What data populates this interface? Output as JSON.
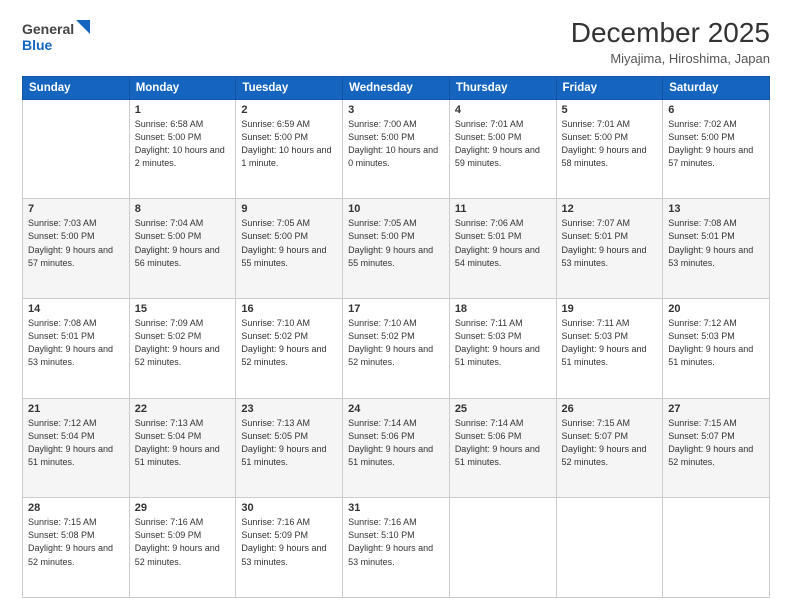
{
  "header": {
    "logo_line1": "General",
    "logo_line2": "Blue",
    "month": "December 2025",
    "location": "Miyajima, Hiroshima, Japan"
  },
  "weekdays": [
    "Sunday",
    "Monday",
    "Tuesday",
    "Wednesday",
    "Thursday",
    "Friday",
    "Saturday"
  ],
  "weeks": [
    [
      {
        "day": "",
        "text": ""
      },
      {
        "day": "1",
        "text": "Sunrise: 6:58 AM\nSunset: 5:00 PM\nDaylight: 10 hours\nand 2 minutes."
      },
      {
        "day": "2",
        "text": "Sunrise: 6:59 AM\nSunset: 5:00 PM\nDaylight: 10 hours\nand 1 minute."
      },
      {
        "day": "3",
        "text": "Sunrise: 7:00 AM\nSunset: 5:00 PM\nDaylight: 10 hours\nand 0 minutes."
      },
      {
        "day": "4",
        "text": "Sunrise: 7:01 AM\nSunset: 5:00 PM\nDaylight: 9 hours\nand 59 minutes."
      },
      {
        "day": "5",
        "text": "Sunrise: 7:01 AM\nSunset: 5:00 PM\nDaylight: 9 hours\nand 58 minutes."
      },
      {
        "day": "6",
        "text": "Sunrise: 7:02 AM\nSunset: 5:00 PM\nDaylight: 9 hours\nand 57 minutes."
      }
    ],
    [
      {
        "day": "7",
        "text": "Sunrise: 7:03 AM\nSunset: 5:00 PM\nDaylight: 9 hours\nand 57 minutes."
      },
      {
        "day": "8",
        "text": "Sunrise: 7:04 AM\nSunset: 5:00 PM\nDaylight: 9 hours\nand 56 minutes."
      },
      {
        "day": "9",
        "text": "Sunrise: 7:05 AM\nSunset: 5:00 PM\nDaylight: 9 hours\nand 55 minutes."
      },
      {
        "day": "10",
        "text": "Sunrise: 7:05 AM\nSunset: 5:00 PM\nDaylight: 9 hours\nand 55 minutes."
      },
      {
        "day": "11",
        "text": "Sunrise: 7:06 AM\nSunset: 5:01 PM\nDaylight: 9 hours\nand 54 minutes."
      },
      {
        "day": "12",
        "text": "Sunrise: 7:07 AM\nSunset: 5:01 PM\nDaylight: 9 hours\nand 53 minutes."
      },
      {
        "day": "13",
        "text": "Sunrise: 7:08 AM\nSunset: 5:01 PM\nDaylight: 9 hours\nand 53 minutes."
      }
    ],
    [
      {
        "day": "14",
        "text": "Sunrise: 7:08 AM\nSunset: 5:01 PM\nDaylight: 9 hours\nand 53 minutes."
      },
      {
        "day": "15",
        "text": "Sunrise: 7:09 AM\nSunset: 5:02 PM\nDaylight: 9 hours\nand 52 minutes."
      },
      {
        "day": "16",
        "text": "Sunrise: 7:10 AM\nSunset: 5:02 PM\nDaylight: 9 hours\nand 52 minutes."
      },
      {
        "day": "17",
        "text": "Sunrise: 7:10 AM\nSunset: 5:02 PM\nDaylight: 9 hours\nand 52 minutes."
      },
      {
        "day": "18",
        "text": "Sunrise: 7:11 AM\nSunset: 5:03 PM\nDaylight: 9 hours\nand 51 minutes."
      },
      {
        "day": "19",
        "text": "Sunrise: 7:11 AM\nSunset: 5:03 PM\nDaylight: 9 hours\nand 51 minutes."
      },
      {
        "day": "20",
        "text": "Sunrise: 7:12 AM\nSunset: 5:03 PM\nDaylight: 9 hours\nand 51 minutes."
      }
    ],
    [
      {
        "day": "21",
        "text": "Sunrise: 7:12 AM\nSunset: 5:04 PM\nDaylight: 9 hours\nand 51 minutes."
      },
      {
        "day": "22",
        "text": "Sunrise: 7:13 AM\nSunset: 5:04 PM\nDaylight: 9 hours\nand 51 minutes."
      },
      {
        "day": "23",
        "text": "Sunrise: 7:13 AM\nSunset: 5:05 PM\nDaylight: 9 hours\nand 51 minutes."
      },
      {
        "day": "24",
        "text": "Sunrise: 7:14 AM\nSunset: 5:06 PM\nDaylight: 9 hours\nand 51 minutes."
      },
      {
        "day": "25",
        "text": "Sunrise: 7:14 AM\nSunset: 5:06 PM\nDaylight: 9 hours\nand 51 minutes."
      },
      {
        "day": "26",
        "text": "Sunrise: 7:15 AM\nSunset: 5:07 PM\nDaylight: 9 hours\nand 52 minutes."
      },
      {
        "day": "27",
        "text": "Sunrise: 7:15 AM\nSunset: 5:07 PM\nDaylight: 9 hours\nand 52 minutes."
      }
    ],
    [
      {
        "day": "28",
        "text": "Sunrise: 7:15 AM\nSunset: 5:08 PM\nDaylight: 9 hours\nand 52 minutes."
      },
      {
        "day": "29",
        "text": "Sunrise: 7:16 AM\nSunset: 5:09 PM\nDaylight: 9 hours\nand 52 minutes."
      },
      {
        "day": "30",
        "text": "Sunrise: 7:16 AM\nSunset: 5:09 PM\nDaylight: 9 hours\nand 53 minutes."
      },
      {
        "day": "31",
        "text": "Sunrise: 7:16 AM\nSunset: 5:10 PM\nDaylight: 9 hours\nand 53 minutes."
      },
      {
        "day": "",
        "text": ""
      },
      {
        "day": "",
        "text": ""
      },
      {
        "day": "",
        "text": ""
      }
    ]
  ]
}
